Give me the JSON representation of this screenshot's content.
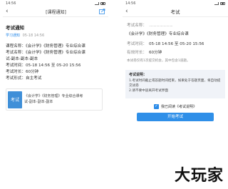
{
  "left": {
    "status": {
      "time": "14:56"
    },
    "nav": {
      "back": "‹",
      "title": "[课程通知]"
    },
    "notice": {
      "title": "考试通知",
      "tag": "学习通知",
      "date": "05-18 14:56"
    },
    "details": [
      "课程名称：《会计学》《财务管理》专业综合课",
      "考试名称：《会计学》《财务管理》专业综合课",
      "试-副本-副本-副本",
      "考试时间：05-18 14:56 至 05-20 15:56",
      "考试时长：60分钟",
      "考试形式：自主考试"
    ],
    "card": {
      "badge": "考试",
      "text_line1": "《会计学》《财务管理》专业综合课考",
      "text_line2": "试-副本-副本-副本"
    }
  },
  "right": {
    "status": {
      "time": "14:56"
    },
    "nav": {
      "back": "‹",
      "title": "考试"
    },
    "rows": {
      "name_label": "考试名称：",
      "name_value": "《会计学》《财务管理》专业综合课",
      "time_label": "考试时间：",
      "time_value": "05-18 14:56 至 05-20 15:56",
      "duration_label": "有效时长：",
      "duration_value": "60分钟"
    },
    "note": "本试卷仅有1次提交机会，其中包含1道题。",
    "instructions": {
      "heading": "考试说明：",
      "lines": [
        "1.考试时间截止或答题时间结束，如果处于答题页面，将自动提交试卷",
        "2.请不要中途离开考试界面"
      ]
    },
    "agree_label": "我已阅读《考试说明》",
    "start_button": "开始考试"
  },
  "watermark": "大玩家",
  "colors": {
    "accent": "#2f8fe8",
    "badge": "#3f8fd8",
    "instructions_bg": "#f0f3f8"
  }
}
